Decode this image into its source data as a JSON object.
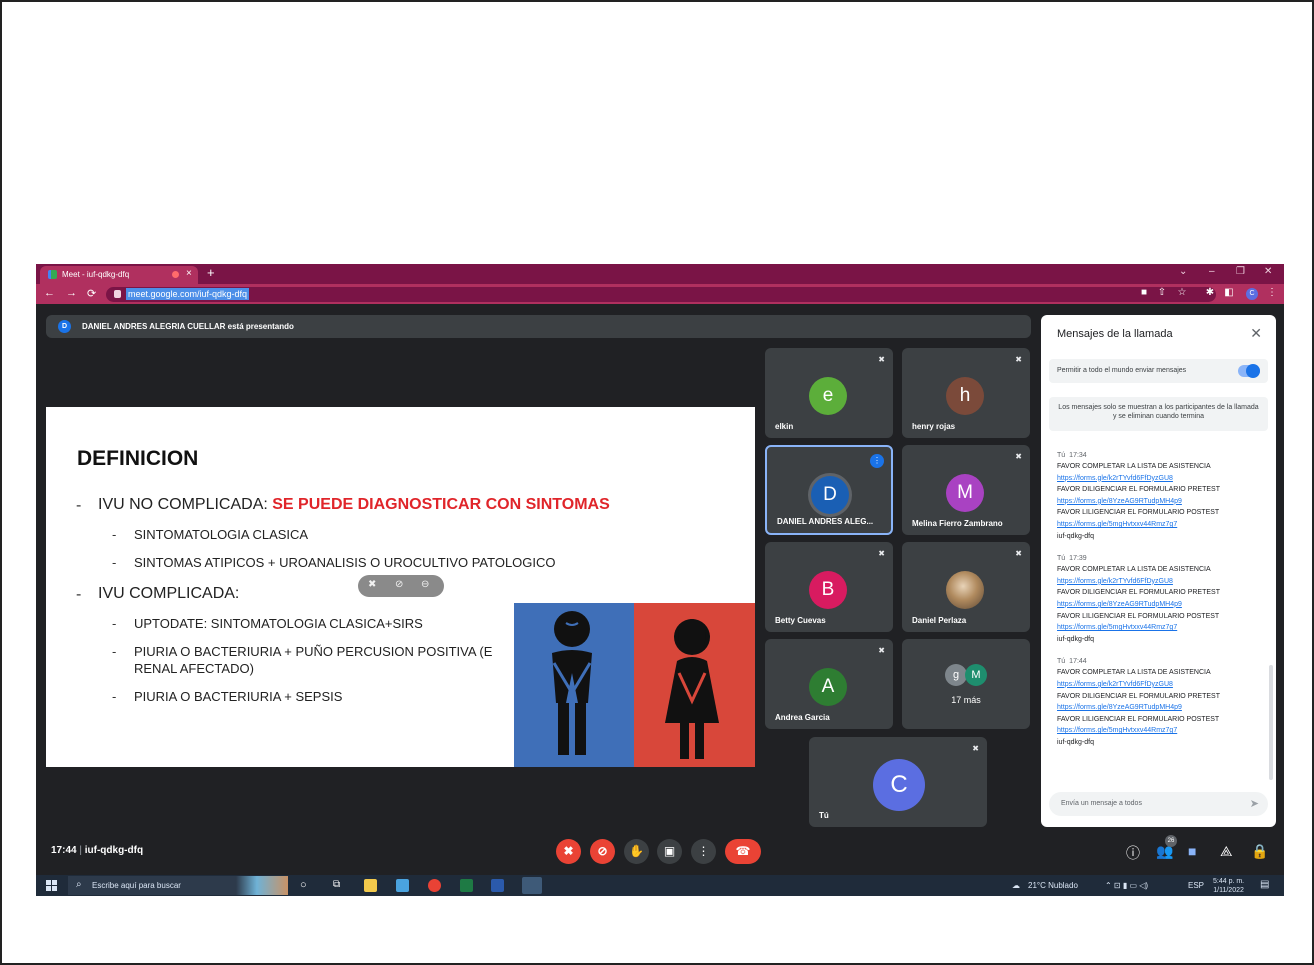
{
  "browser": {
    "tab_title": "Meet - iuf-qdkg-dfq",
    "tab_close": "×",
    "new_tab": "+",
    "url": "meet.google.com/iuf-qdkg-dfq",
    "profile_initial": "C",
    "window_controls": [
      "⌄",
      "–",
      "❐",
      "✕"
    ]
  },
  "banner": {
    "avatar": "D",
    "text": "DANIEL ANDRES ALEGRIA CUELLAR está presentando"
  },
  "slide": {
    "title": "DEFINICION",
    "items": [
      {
        "text": "IVU NO COMPLICADA: ",
        "highlight": "SE PUEDE DIAGNOSTICAR CON SINTOMAS"
      },
      {
        "text": "SINTOMATOLOGIA CLASICA"
      },
      {
        "text": "SINTOMAS ATIPICOS + UROANALISIS O UROCULTIVO PATOLOGICO"
      },
      {
        "text": "IVU COMPLICADA:"
      },
      {
        "text": "UPTODATE: SINTOMATOLOGIA CLASICA+SIRS"
      },
      {
        "text": "PIURIA O BACTERIURIA + PUÑO PERCUSION POSITIVA (E"
      },
      {
        "text": "RENAL AFECTADO)"
      },
      {
        "text": "PIURIA O BACTERIURIA + SEPSIS"
      }
    ]
  },
  "participants": [
    {
      "initial": "e",
      "name": "elkin",
      "color": "#5cae3a"
    },
    {
      "initial": "h",
      "name": "henry rojas",
      "color": "#7b4a3a"
    },
    {
      "initial": "D",
      "name": "DANIEL ANDRES ALEG...",
      "color": "#1a5fb4"
    },
    {
      "initial": "M",
      "name": "Melina Fierro Zambrano",
      "color": "#a942c2"
    },
    {
      "initial": "B",
      "name": "Betty Cuevas",
      "color": "#d81b60"
    },
    {
      "initial": "",
      "name": "Daniel Perlaza",
      "color": "#8a7a60"
    },
    {
      "initial": "A",
      "name": "Andrea Garcia",
      "color": "#2e7d32"
    },
    {
      "initial": "",
      "name": "17 más",
      "color": "#3c4043",
      "mini": [
        "g",
        "M"
      ]
    },
    {
      "initial": "C",
      "name": "Tú",
      "color": "#5b6ee1"
    }
  ],
  "chat": {
    "title": "Mensajes de la llamada",
    "permission_label": "Permitir a todo el mundo enviar mensajes",
    "info": "Los mensajes solo se muestran a los participantes de la llamada y se eliminan cuando termina",
    "messages": [
      {
        "sender": "Tú",
        "time": "17:34"
      },
      {
        "sender": "Tú",
        "time": "17:39"
      },
      {
        "sender": "Tú",
        "time": "17:44"
      }
    ],
    "lines": {
      "asistencia": "FAVOR COMPLETAR LA LISTA DE ASISTENCIA",
      "link1": "https://forms.gle/k2rTYvfd6FfDyzGU8",
      "pretest": "FAVOR DILIGENCIAR EL FORMULARIO PRETEST",
      "link2": "https://forms.gle/8YzeAG9RTudpMH4p9",
      "postest": "FAVOR LILIGENCIAR EL FORMULARIO POSTEST",
      "link3": "https://forms.gle/5mgHvtxxv44Rmz7g7",
      "code": "iuf-qdkg-dfq"
    },
    "composer_placeholder": "Envía un mensaje a todos"
  },
  "meetbar": {
    "time": "17:44",
    "separator": "|",
    "code": "iuf-qdkg-dfq",
    "participant_count": "26"
  },
  "taskbar": {
    "search_placeholder": "Escribe aquí para buscar",
    "weather": "21°C Nublado",
    "lang": "ESP",
    "time": "5:44 p. m.",
    "date": "1/11/2022"
  }
}
